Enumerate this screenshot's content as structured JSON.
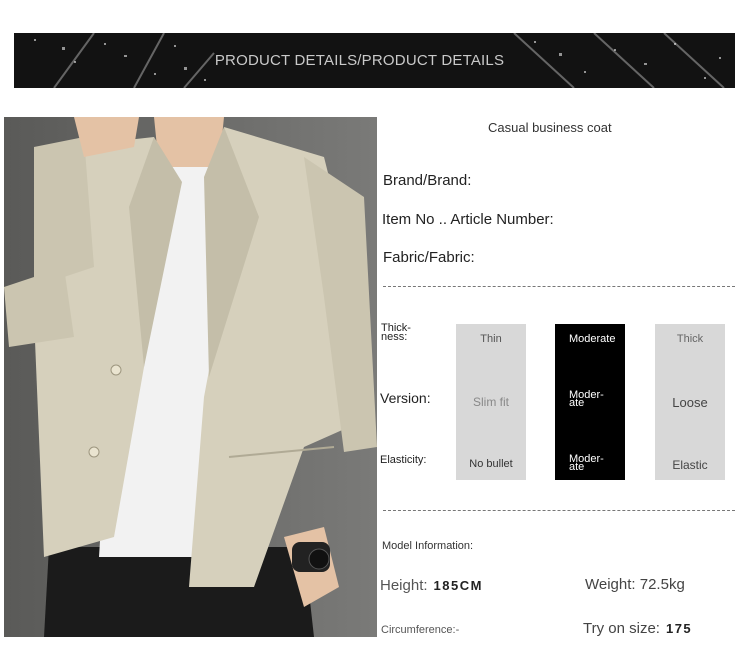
{
  "banner": {
    "title": "PRODUCT DETAILS/PRODUCT DETAILS"
  },
  "product": {
    "name": "Casual business coat"
  },
  "specs": {
    "brand": "Brand/Brand:",
    "item_no": "Item No .. Article Number:",
    "fabric": "Fabric/Fabric:"
  },
  "attributes": {
    "thickness_label": [
      "Thick-",
      "ness:"
    ],
    "version_label": "Version:",
    "elasticity_label": "Elasticity:",
    "columns": [
      {
        "thickness": "Thin",
        "version": "Slim fit",
        "elasticity": "No bullet",
        "selected": false
      },
      {
        "thickness": "Moderate",
        "version": [
          "Moder-",
          "ate"
        ],
        "elasticity": [
          "Moder-",
          "ate"
        ],
        "selected": true
      },
      {
        "thickness": "Thick",
        "version": "Loose",
        "elasticity": "Elastic",
        "selected": false
      }
    ]
  },
  "model": {
    "title": "Model Information:",
    "height_label": "Height:",
    "height_value": "185CM",
    "weight_label": "Weight: 72.5kg",
    "circumference_label": "Circumference:-",
    "try_on_label": "Try on size:",
    "try_on_value": "175"
  },
  "colors": {
    "banner_bg": "#121212",
    "selected_bg": "#000000",
    "unselected_bg": "#d8d8d8",
    "coat": "#d6d0bc"
  }
}
